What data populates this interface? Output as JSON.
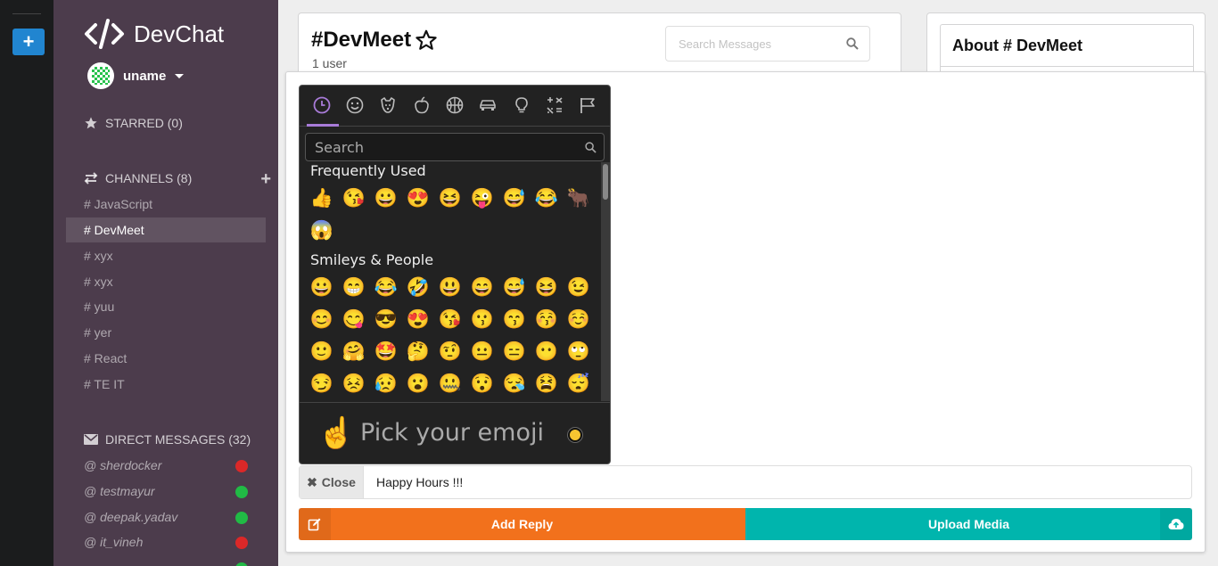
{
  "brand": {
    "name": "DevChat"
  },
  "user": {
    "name": "uname"
  },
  "sidebar": {
    "starred_label": "STARRED (0)",
    "channels_label": "CHANNELS (8)",
    "channels": [
      {
        "label": "# JavaScript",
        "active": false
      },
      {
        "label": "# DevMeet",
        "active": true
      },
      {
        "label": "# xyx",
        "active": false
      },
      {
        "label": "# xyx",
        "active": false
      },
      {
        "label": "# yuu",
        "active": false
      },
      {
        "label": "# yer",
        "active": false
      },
      {
        "label": "# React",
        "active": false
      },
      {
        "label": "# TE IT",
        "active": false
      }
    ],
    "dms_label": "DIRECT MESSAGES (32)",
    "dms": [
      {
        "label": "@ sherdocker",
        "status": "offline"
      },
      {
        "label": "@ testmayur",
        "status": "online"
      },
      {
        "label": "@ deepak.yadav",
        "status": "online"
      },
      {
        "label": "@ it_vineh",
        "status": "offline"
      },
      {
        "label": "",
        "status": "online"
      }
    ]
  },
  "header": {
    "title": "#DevMeet",
    "subtitle": "1 user",
    "search_placeholder": "Search Messages"
  },
  "about": {
    "title": "About # DevMeet"
  },
  "emoji_picker": {
    "search_placeholder": "Search",
    "categories": [
      "recent",
      "smileys",
      "animals",
      "food",
      "activity",
      "travel",
      "objects",
      "symbols",
      "flags"
    ],
    "sections": [
      {
        "label": "Frequently Used",
        "emojis": [
          "👍",
          "😘",
          "😀",
          "😍",
          "😆",
          "😜",
          "😅",
          "😂",
          "🐂",
          "😱"
        ]
      },
      {
        "label": "Smileys & People",
        "emojis": [
          "😀",
          "😁",
          "😂",
          "🤣",
          "😃",
          "😄",
          "😅",
          "😆",
          "😉",
          "😊",
          "😋",
          "😎",
          "😍",
          "😘",
          "😗",
          "😙",
          "😚",
          "☺️",
          "🙂",
          "🤗",
          "🤩",
          "🤔",
          "🤨",
          "😐",
          "😑",
          "😶",
          "🙄",
          "😏",
          "😣",
          "😥",
          "😮",
          "🤐",
          "😯",
          "😪",
          "😫",
          "😴"
        ]
      }
    ],
    "preview_emoji": "☝️",
    "preview_text": "Pick your emoji"
  },
  "composer": {
    "close_label": "Close",
    "message_value": "Happy Hours !!!",
    "reply_label": "Add Reply",
    "upload_label": "Upload Media"
  },
  "colors": {
    "sidebar_bg": "#4c3c4c",
    "rail_bg": "#1b1c1d",
    "accent_blue": "#2185d0",
    "reply_orange": "#f2711c",
    "upload_teal": "#00b5ad",
    "online_green": "#21ba45",
    "offline_red": "#db2828",
    "picker_bg": "#222222",
    "picker_accent": "#a87bd8"
  }
}
